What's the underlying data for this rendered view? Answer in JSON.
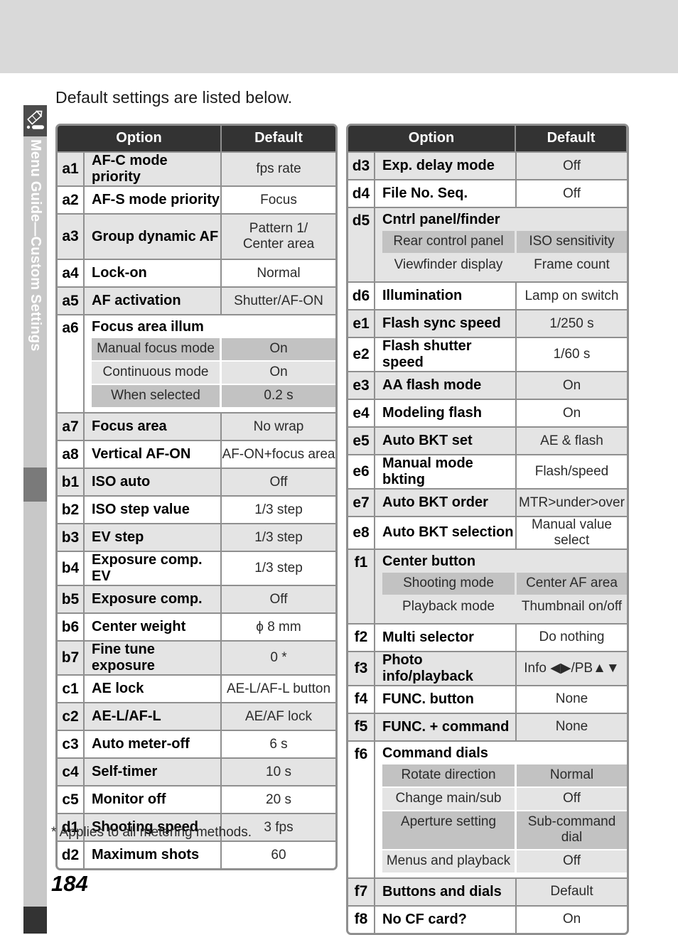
{
  "sidebar": {
    "tab_icon": "pencil-icon",
    "label": "Menu Guide—Custom Settings"
  },
  "page": {
    "intro": "Default settings are listed below.",
    "footnote": "* Applies to all metering methods.",
    "folio": "184"
  },
  "colors": {
    "header_bg": "#333333",
    "row_shade": "#e4e4e4",
    "row_plain": "#ffffff",
    "subrow_dark": "#c2c2c2",
    "subrow_light": "#e4e4e4",
    "border": "#8f8f8f",
    "top_band": "#d9d9d9",
    "side_strip": "#c8c8c8"
  },
  "tables": [
    {
      "id": "left",
      "headers": {
        "option": "Option",
        "default": "Default"
      },
      "rows": [
        {
          "type": "simple",
          "code": "a1",
          "option": "AF-C mode priority",
          "value": "fps rate",
          "shade": "shade"
        },
        {
          "type": "simple",
          "code": "a2",
          "option": "AF-S mode priority",
          "value": "Focus",
          "shade": "plain"
        },
        {
          "type": "simple",
          "code": "a3",
          "option": "Group dynamic AF",
          "value": "Pattern 1/\nCenter area",
          "shade": "shade",
          "tall": true
        },
        {
          "type": "simple",
          "code": "a4",
          "option": "Lock-on",
          "value": "Normal",
          "shade": "plain"
        },
        {
          "type": "simple",
          "code": "a5",
          "option": "AF activation",
          "value": "Shutter/AF-ON",
          "shade": "shade"
        },
        {
          "type": "group",
          "code": "a6",
          "option": "Focus area illum",
          "shade": "plain",
          "subrows": [
            {
              "name": "Manual focus mode",
              "value": "On",
              "tone": "dk"
            },
            {
              "name": "Continuous mode",
              "value": "On",
              "tone": "lt"
            },
            {
              "name": "When selected",
              "value": "0.2 s",
              "tone": "dk"
            }
          ]
        },
        {
          "type": "simple",
          "code": "a7",
          "option": "Focus area",
          "value": "No wrap",
          "shade": "shade"
        },
        {
          "type": "simple",
          "code": "a8",
          "option": "Vertical AF-ON",
          "value": "AF-ON+focus area",
          "shade": "plain"
        },
        {
          "type": "simple",
          "code": "b1",
          "option": "ISO auto",
          "value": "Off",
          "shade": "shade"
        },
        {
          "type": "simple",
          "code": "b2",
          "option": "ISO step value",
          "value": "1/3 step",
          "shade": "plain"
        },
        {
          "type": "simple",
          "code": "b3",
          "option": "EV step",
          "value": "1/3 step",
          "shade": "shade"
        },
        {
          "type": "simple",
          "code": "b4",
          "option": "Exposure comp. EV",
          "value": "1/3 step",
          "shade": "plain"
        },
        {
          "type": "simple",
          "code": "b5",
          "option": "Exposure comp.",
          "value": "Off",
          "shade": "shade"
        },
        {
          "type": "simple",
          "code": "b6",
          "option": "Center weight",
          "value": "ϕ 8 mm",
          "shade": "plain"
        },
        {
          "type": "simple",
          "code": "b7",
          "option": "Fine tune exposure",
          "value": "0 *",
          "shade": "shade"
        },
        {
          "type": "simple",
          "code": "c1",
          "option": "AE lock",
          "value": "AE-L/AF-L button",
          "shade": "plain"
        },
        {
          "type": "simple",
          "code": "c2",
          "option": "AE-L/AF-L",
          "value": "AE/AF lock",
          "shade": "shade"
        },
        {
          "type": "simple",
          "code": "c3",
          "option": "Auto meter-off",
          "value": "6 s",
          "shade": "plain"
        },
        {
          "type": "simple",
          "code": "c4",
          "option": "Self-timer",
          "value": "10 s",
          "shade": "shade"
        },
        {
          "type": "simple",
          "code": "c5",
          "option": "Monitor off",
          "value": "20 s",
          "shade": "plain"
        },
        {
          "type": "simple",
          "code": "d1",
          "option": "Shooting speed",
          "value": "3 fps",
          "shade": "shade"
        },
        {
          "type": "simple",
          "code": "d2",
          "option": "Maximum shots",
          "value": "60",
          "shade": "plain"
        }
      ]
    },
    {
      "id": "right",
      "headers": {
        "option": "Option",
        "default": "Default"
      },
      "rows": [
        {
          "type": "simple",
          "code": "d3",
          "option": "Exp. delay mode",
          "value": "Off",
          "shade": "shade"
        },
        {
          "type": "simple",
          "code": "d4",
          "option": "File No. Seq.",
          "value": "Off",
          "shade": "plain"
        },
        {
          "type": "group",
          "code": "d5",
          "option": "Cntrl panel/finder",
          "shade": "shade",
          "subrows": [
            {
              "name": "Rear control panel",
              "value": "ISO sensitivity",
              "tone": "dk"
            },
            {
              "name": "Viewfinder display",
              "value": "Frame count",
              "tone": "lt"
            }
          ]
        },
        {
          "type": "simple",
          "code": "d6",
          "option": "Illumination",
          "value": "Lamp on switch",
          "shade": "plain"
        },
        {
          "type": "simple",
          "code": "e1",
          "option": "Flash sync speed",
          "value": "1/250 s",
          "shade": "shade"
        },
        {
          "type": "simple",
          "code": "e2",
          "option": "Flash shutter speed",
          "value": "1/60 s",
          "shade": "plain"
        },
        {
          "type": "simple",
          "code": "e3",
          "option": "AA flash mode",
          "value": "On",
          "shade": "shade"
        },
        {
          "type": "simple",
          "code": "e4",
          "option": "Modeling flash",
          "value": "On",
          "shade": "plain"
        },
        {
          "type": "simple",
          "code": "e5",
          "option": "Auto BKT set",
          "value": "AE & flash",
          "shade": "shade"
        },
        {
          "type": "simple",
          "code": "e6",
          "option": "Manual mode bkting",
          "value": "Flash/speed",
          "shade": "plain"
        },
        {
          "type": "simple",
          "code": "e7",
          "option": "Auto BKT order",
          "value": "MTR>under>over",
          "shade": "shade"
        },
        {
          "type": "simple",
          "code": "e8",
          "option": "Auto BKT selection",
          "value": "Manual value select",
          "shade": "plain"
        },
        {
          "type": "group",
          "code": "f1",
          "option": "Center button",
          "shade": "shade",
          "subrows": [
            {
              "name": "Shooting mode",
              "value": "Center AF area",
              "tone": "dk"
            },
            {
              "name": "Playback mode",
              "value": "Thumbnail on/off",
              "tone": "lt"
            }
          ]
        },
        {
          "type": "simple",
          "code": "f2",
          "option": "Multi selector",
          "value": "Do nothing",
          "shade": "plain"
        },
        {
          "type": "simple",
          "code": "f3",
          "option": "Photo info/playback",
          "value": "Info ◀▶/PB▲▼",
          "shade": "shade"
        },
        {
          "type": "simple",
          "code": "f4",
          "option": "FUNC. button",
          "value": "None",
          "shade": "plain"
        },
        {
          "type": "simple",
          "code": "f5",
          "option": "FUNC. + command",
          "value": "None",
          "shade": "shade"
        },
        {
          "type": "group",
          "code": "f6",
          "option": "Command dials",
          "shade": "plain",
          "subrows": [
            {
              "name": "Rotate direction",
              "value": "Normal",
              "tone": "dk"
            },
            {
              "name": "Change main/sub",
              "value": "Off",
              "tone": "lt"
            },
            {
              "name": "Aperture setting",
              "value": "Sub-command dial",
              "tone": "dk"
            },
            {
              "name": "Menus and playback",
              "value": "Off",
              "tone": "lt"
            }
          ]
        },
        {
          "type": "simple",
          "code": "f7",
          "option": "Buttons and dials",
          "value": "Default",
          "shade": "shade"
        },
        {
          "type": "simple",
          "code": "f8",
          "option": "No CF card?",
          "value": "On",
          "shade": "plain"
        }
      ]
    }
  ]
}
